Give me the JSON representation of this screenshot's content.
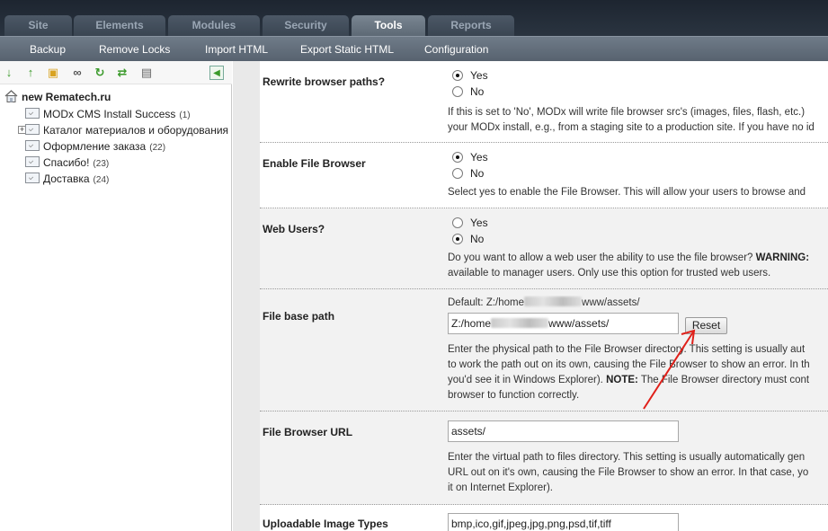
{
  "top_tabs": [
    {
      "label": "Site",
      "active": false
    },
    {
      "label": "Elements",
      "active": false
    },
    {
      "label": "Modules",
      "active": false
    },
    {
      "label": "Security",
      "active": false
    },
    {
      "label": "Tools",
      "active": true
    },
    {
      "label": "Reports",
      "active": false
    }
  ],
  "sub_menu": [
    "Backup",
    "Remove Locks",
    "Import HTML",
    "Export Static HTML",
    "Configuration"
  ],
  "tree": {
    "toolbar_icons": [
      "expand-tree-icon",
      "collapse-tree-icon",
      "new-folder-icon",
      "new-weblink-icon",
      "refresh-icon",
      "sort-icon",
      "purge-icon",
      "hide-tree-icon"
    ],
    "root": "new Rematech.ru",
    "items": [
      {
        "label": "MODx CMS Install Success",
        "count": "(1)"
      },
      {
        "label": "Каталог материалов и оборудования",
        "count": ""
      },
      {
        "label": "Оформление заказа",
        "count": "(22)"
      },
      {
        "label": "Спасибо!",
        "count": "(23)"
      },
      {
        "label": "Доставка",
        "count": "(24)"
      }
    ]
  },
  "settings": {
    "rewrite": {
      "label": "Rewrite browser paths?",
      "yes": "Yes",
      "no": "No",
      "desc1": "If this is set to 'No', MODx will write file browser src's (images, files, flash, etc.)",
      "desc2": "your MODx install, e.g., from a staging site to a production site. If you have no id"
    },
    "file_browser": {
      "label": "Enable File Browser",
      "yes": "Yes",
      "no": "No",
      "desc1": "Select yes to enable the File Browser. This will allow your users to browse and"
    },
    "web_users": {
      "label": "Web Users?",
      "yes": "Yes",
      "no": "No",
      "desc1": "Do you want to allow a web user the ability to use the file browser?",
      "warning": "WARNING:",
      "desc2": "available to manager users. Only use this option for trusted web users."
    },
    "base_path": {
      "label": "File base path",
      "default_prefix": "Default: Z:/home",
      "default_suffix": "www/assets/",
      "value_prefix": "Z:/home",
      "value_suffix": "www/assets/",
      "reset": "Reset",
      "desc1": "Enter the physical path to the File Browser directory. This setting is usually aut",
      "desc2": "to work the path out on its own, causing the File Browser to show an error. In th",
      "desc3a": "you'd see it in Windows Explorer).",
      "note": "NOTE:",
      "desc3b": "The File Browser directory must cont",
      "desc4": "browser to function correctly."
    },
    "browser_url": {
      "label": "File Browser URL",
      "value": "assets/",
      "desc1": "Enter the virtual path to files directory. This setting is usually automatically gen",
      "desc2": "URL out on it's own, causing the File Browser to show an error. In that case, yo",
      "desc3": "it on Internet Explorer)."
    },
    "image_types": {
      "label": "Uploadable Image Types",
      "value": "bmp,ico,gif,jpeg,jpg,png,psd,tif,tiff"
    }
  },
  "colors": {
    "annotation_arrow": "#e0201a",
    "active_tab": "#6a7682"
  }
}
